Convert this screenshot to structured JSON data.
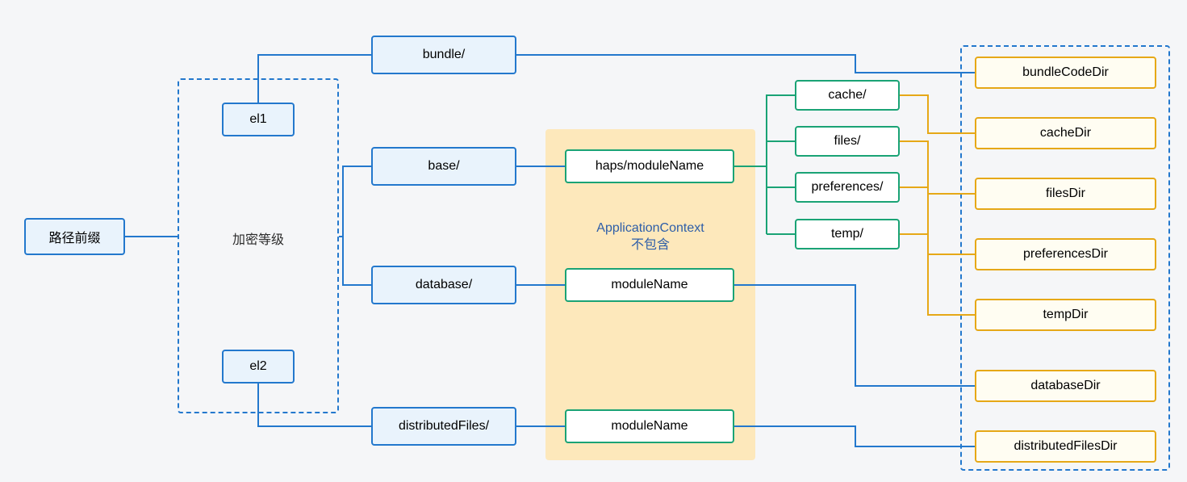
{
  "root": {
    "label": "路径前缀"
  },
  "encryption": {
    "group_label": "加密等级",
    "el1": "el1",
    "el2": "el2"
  },
  "paths": {
    "bundle": "bundle/",
    "base": "base/",
    "database": "database/",
    "distributedFiles": "distributedFiles/"
  },
  "appcontext_area": {
    "title_line1": "ApplicationContext",
    "title_line2": "不包含"
  },
  "modules": {
    "haps": "haps/moduleName",
    "db_module": "moduleName",
    "dist_module": "moduleName"
  },
  "subdirs": {
    "cache": "cache/",
    "files": "files/",
    "preferences": "preferences/",
    "temp": "temp/"
  },
  "dirs": {
    "bundleCodeDir": "bundleCodeDir",
    "cacheDir": "cacheDir",
    "filesDir": "filesDir",
    "preferencesDir": "preferencesDir",
    "tempDir": "tempDir",
    "databaseDir": "databaseDir",
    "distributedFilesDir": "distributedFilesDir"
  }
}
